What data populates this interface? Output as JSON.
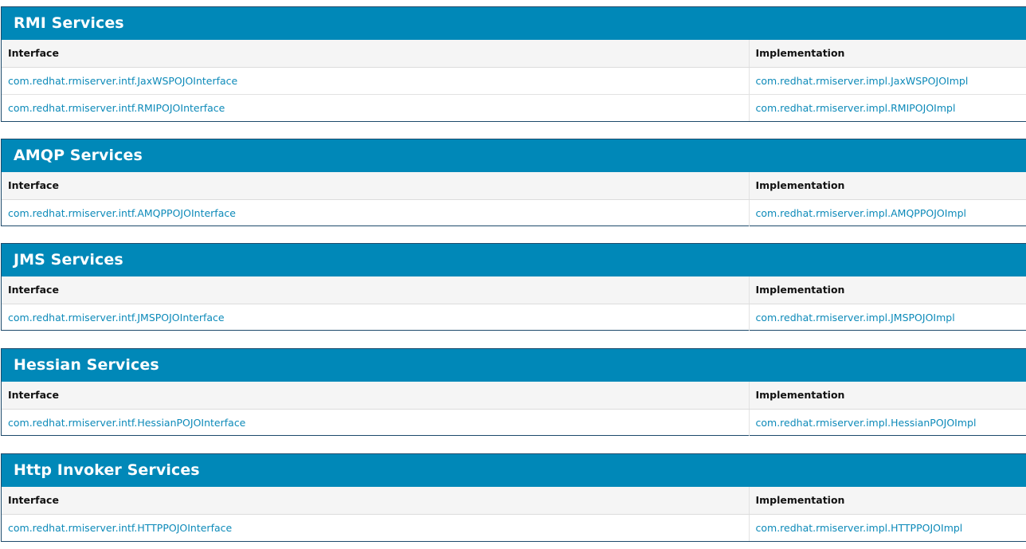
{
  "headers": {
    "interface": "Interface",
    "implementation": "Implementation"
  },
  "colors": {
    "header_bg": "#0088b8",
    "link": "#0d8ab9",
    "border": "#1d4a6b"
  },
  "sections": [
    {
      "title": "RMI Services",
      "rows": [
        {
          "interface": "com.redhat.rmiserver.intf.JaxWSPOJOInterface",
          "implementation": "com.redhat.rmiserver.impl.JaxWSPOJOImpl"
        },
        {
          "interface": "com.redhat.rmiserver.intf.RMIPOJOInterface",
          "implementation": "com.redhat.rmiserver.impl.RMIPOJOImpl"
        }
      ]
    },
    {
      "title": "AMQP Services",
      "rows": [
        {
          "interface": "com.redhat.rmiserver.intf.AMQPPOJOInterface",
          "implementation": "com.redhat.rmiserver.impl.AMQPPOJOImpl"
        }
      ]
    },
    {
      "title": "JMS Services",
      "rows": [
        {
          "interface": "com.redhat.rmiserver.intf.JMSPOJOInterface",
          "implementation": "com.redhat.rmiserver.impl.JMSPOJOImpl"
        }
      ]
    },
    {
      "title": "Hessian Services",
      "rows": [
        {
          "interface": "com.redhat.rmiserver.intf.HessianPOJOInterface",
          "implementation": "com.redhat.rmiserver.impl.HessianPOJOImpl"
        }
      ]
    },
    {
      "title": "Http Invoker Services",
      "rows": [
        {
          "interface": "com.redhat.rmiserver.intf.HTTPPOJOInterface",
          "implementation": "com.redhat.rmiserver.impl.HTTPPOJOImpl"
        }
      ]
    }
  ]
}
